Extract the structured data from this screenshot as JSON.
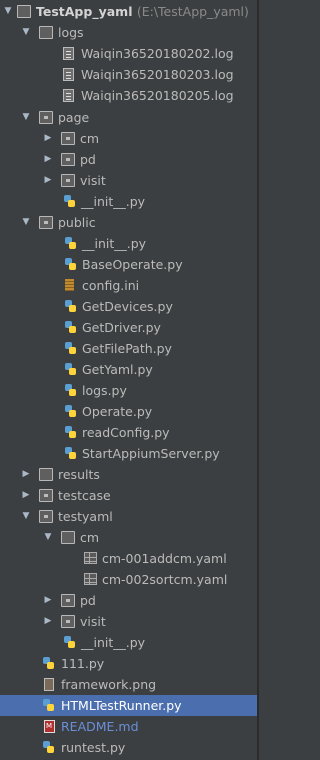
{
  "project": {
    "name": "TestApp_yaml",
    "path": "(E:\\TestApp_yaml)"
  },
  "rows": [
    {
      "label": "logs"
    },
    {
      "label": "Waiqin36520180202.log"
    },
    {
      "label": "Waiqin36520180203.log"
    },
    {
      "label": "Waiqin36520180205.log"
    },
    {
      "label": "page"
    },
    {
      "label": "cm"
    },
    {
      "label": "pd"
    },
    {
      "label": "visit"
    },
    {
      "label": "__init__.py"
    },
    {
      "label": "public"
    },
    {
      "label": "__init__.py"
    },
    {
      "label": "BaseOperate.py"
    },
    {
      "label": "config.ini"
    },
    {
      "label": "GetDevices.py"
    },
    {
      "label": "GetDriver.py"
    },
    {
      "label": "GetFilePath.py"
    },
    {
      "label": "GetYaml.py"
    },
    {
      "label": "logs.py"
    },
    {
      "label": "Operate.py"
    },
    {
      "label": "readConfig.py"
    },
    {
      "label": "StartAppiumServer.py"
    },
    {
      "label": "results"
    },
    {
      "label": "testcase"
    },
    {
      "label": "testyaml"
    },
    {
      "label": "cm"
    },
    {
      "label": "cm-001addcm.yaml"
    },
    {
      "label": "cm-002sortcm.yaml"
    },
    {
      "label": "pd"
    },
    {
      "label": "visit"
    },
    {
      "label": "__init__.py"
    },
    {
      "label": "111.py"
    },
    {
      "label": "framework.png"
    },
    {
      "label": "HTMLTestRunner.py"
    },
    {
      "label": "README.md"
    },
    {
      "label": "runtest.py"
    }
  ],
  "colors": {
    "background": "#3c3f41",
    "selected": "#4b6eaf",
    "text": "#bbbbbb"
  }
}
